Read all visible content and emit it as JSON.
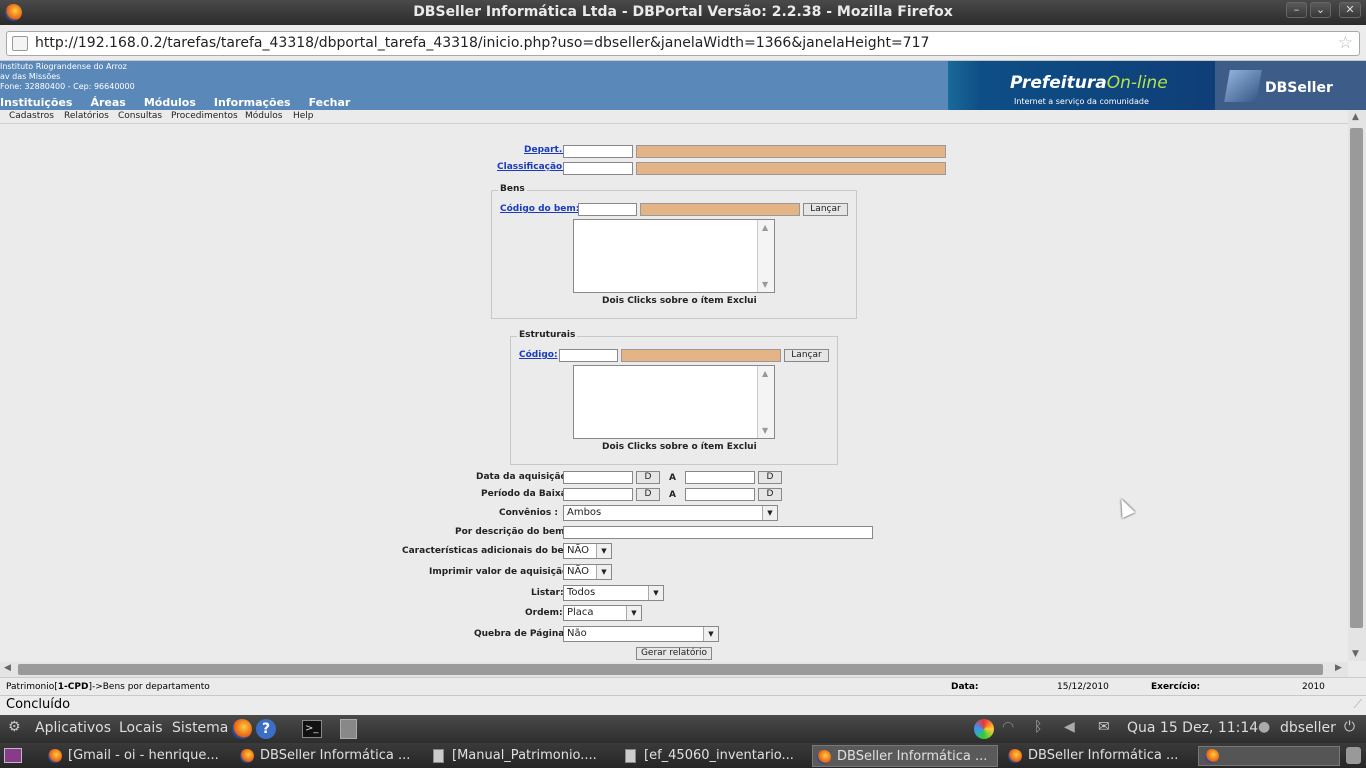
{
  "window": {
    "title": "DBSeller Informática Ltda - DBPortal Versão: 2.2.38 - Mozilla Firefox"
  },
  "browser": {
    "url": "http://192.168.0.2/tarefas/tarefa_43318/dbportal_tarefa_43318/inicio.php?uso=dbseller&janelaWidth=1366&janelaHeight=717",
    "status": "Concluído"
  },
  "header": {
    "inst_name": "Instituto Riograndense do Arroz",
    "inst_addr": "av das Missões",
    "inst_phone": "Fone: 32880400  -  Cep: 96640000",
    "menu": [
      "Instituições",
      "Áreas",
      "Módulos",
      "Informações",
      "Fechar"
    ],
    "pref_title": "Prefeitura",
    "pref_online": "On-line",
    "pref_sub": "Internet a serviço da comunidade",
    "dbseller": "DBSeller"
  },
  "submenu": [
    "Cadastros",
    "Relatórios",
    "Consultas",
    "Procedimentos",
    "Módulos",
    "Help"
  ],
  "form": {
    "depart_label": "Depart.:",
    "classificacao_label": "Classificação:",
    "bens_legend": "Bens",
    "codigo_bem_label": "Código do bem:",
    "lancar": "Lançar",
    "hint": "Dois Clicks sobre o ítem Exclui",
    "estruturais_legend": "Estruturais",
    "codigo_label": "Código:",
    "data_aquisicao_label": "Data da aquisição:",
    "periodo_baixa_label": "Período da Baixa",
    "d_btn": "D",
    "a_label": "A",
    "convenios_label": "Convênios :",
    "convenios_value": "Ambos",
    "descricao_label": "Por descrição do bem:",
    "caracteristicas_label": "Características adicionais do bem:",
    "caracteristicas_value": "NÃO",
    "imprimir_label": "Imprimir valor de aquisição:",
    "imprimir_value": "NÃO",
    "listar_label": "Listar:",
    "listar_value": "Todos",
    "ordem_label": "Ordem:",
    "ordem_value": "Placa",
    "quebra_label": "Quebra de Página:",
    "quebra_value": "Não",
    "gerar": "Gerar relatório"
  },
  "appstatus": {
    "path_prefix": "Patrimonio[",
    "path_bold": "1-CPD",
    "path_suffix": "]->Bens por departamento",
    "data_label": "Data:",
    "data_value": "15/12/2010",
    "exercicio_label": "Exercício:",
    "exercicio_value": "2010"
  },
  "panel": {
    "aplicativos": "Aplicativos",
    "locais": "Locais",
    "sistema": "Sistema",
    "clock": "Qua 15 Dez, 11:14",
    "user": "dbseller"
  },
  "taskbar": [
    "[Gmail - oi - henrique...",
    "DBSeller Informática ...",
    "[Manual_Patrimonio....",
    "[ef_45060_inventario...",
    "DBSeller Informática ...",
    "DBSeller Informática ..."
  ]
}
